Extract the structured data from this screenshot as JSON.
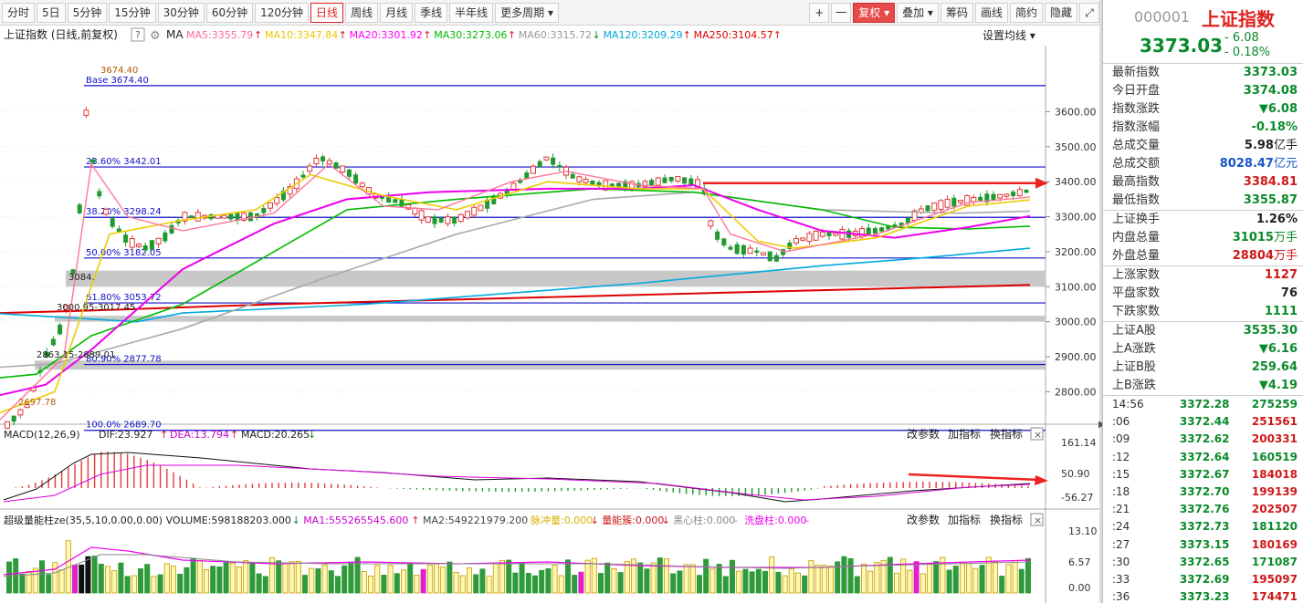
{
  "toolbar": {
    "periods": [
      "分时",
      "5日",
      "5分钟",
      "15分钟",
      "30分钟",
      "60分钟",
      "120分钟",
      "日线",
      "周线",
      "月线",
      "季线",
      "半年线",
      "更多周期"
    ],
    "active_period": "日线",
    "plus": "+",
    "minus": "一",
    "fuquan": "复权",
    "overlay": "叠加",
    "chips": "筹码",
    "draw": "画线",
    "simple": "简约",
    "hide": "隐藏"
  },
  "ma_bar": {
    "title": "上证指数 (日线,前复权)",
    "ma_label": "MA",
    "items": [
      {
        "label": "MA5:3355.79",
        "color": "#ff6699",
        "arrow": "↑"
      },
      {
        "label": "MA10:3347.84",
        "color": "#e8c800",
        "arrow": "↑"
      },
      {
        "label": "MA20:3301.92",
        "color": "#ff00ff",
        "arrow": "↑"
      },
      {
        "label": "MA30:3273.06",
        "color": "#00bb00",
        "arrow": "↑"
      },
      {
        "label": "MA60:3315.72",
        "color": "#999999",
        "arrow": "↓"
      },
      {
        "label": "MA120:3209.29",
        "color": "#00aadd",
        "arrow": "↑"
      },
      {
        "label": "MA250:3104.57",
        "color": "#dd0000",
        "arrow": "↑"
      }
    ],
    "settings": "设置均线"
  },
  "price_axis": [
    "3600.00",
    "3500.00",
    "3400.00",
    "3300.00",
    "3200.00",
    "3100.00",
    "3000.00",
    "2900.00",
    "2800.00"
  ],
  "fib": [
    {
      "label": "Base   3674.40"
    },
    {
      "label": "23.60% 3442.01"
    },
    {
      "label": "38.20% 3298.24"
    },
    {
      "label": "50.00% 3182.05"
    },
    {
      "label": "61.80% 3053.72"
    },
    {
      "label": "80.90% 2877.78"
    },
    {
      "label": "100.0% 2689.70"
    }
  ],
  "price_annotations": {
    "high": "3674.40",
    "low": "2697.78",
    "gap1": "3084.",
    "gap2": "3000.95-3017.45",
    "gap3": "2863.15-2889.01"
  },
  "macd": {
    "title": "MACD(12,26,9)",
    "dif": "DIF:23.927",
    "dea": "DEA:13.794",
    "macd": "MACD:20.265",
    "dif_arrow": "↑",
    "dea_arrow": "↑",
    "macd_arrow": "↓",
    "axis": [
      "161.14",
      "50.90",
      "-56.27"
    ],
    "btn_params": "改参数",
    "btn_add": "加指标",
    "btn_switch": "换指标",
    "close": "×"
  },
  "volume": {
    "title": "超级量能柱ze(35,5,10,0.00,0.00)",
    "volume": "VOLUME:598188203.000",
    "volume_arrow": "↓",
    "ma1": "MA1:555265545.600",
    "ma1_arrow": "↑",
    "ma2": "MA2:549221979.200",
    "pulse": "脉冲量:0.000",
    "pulse_arrow": "↓",
    "burst": "量能簇:0.000",
    "burst_arrow": "↓",
    "black": "黑心柱:0.000",
    "black_dash": "–",
    "wash": "洗盘柱:0.000",
    "wash_dash": "–",
    "axis": [
      "13.10",
      "6.57",
      "0.00"
    ],
    "btn_params": "改参数",
    "btn_add": "加指标",
    "btn_switch": "换指标",
    "close": "×"
  },
  "quote": {
    "code": "000001",
    "name": "上证指数",
    "price": "3373.03",
    "change": "- 6.08",
    "pct": "- 0.18%",
    "section1": [
      {
        "label": "最新指数",
        "value": "3373.03",
        "cls": "g"
      },
      {
        "label": "今日开盘",
        "value": "3374.08",
        "cls": "g"
      },
      {
        "label": "指数涨跌",
        "value": "▼6.08",
        "cls": "g"
      },
      {
        "label": "指数涨幅",
        "value": "-0.18%",
        "cls": "g"
      },
      {
        "label": "总成交量",
        "value": "5.98",
        "unit": "亿手",
        "cls": "k"
      },
      {
        "label": "总成交额",
        "value": "8028.47",
        "unit": "亿元",
        "cls": "b"
      },
      {
        "label": "最高指数",
        "value": "3384.81",
        "cls": "r"
      },
      {
        "label": "最低指数",
        "value": "3355.87",
        "cls": "g"
      }
    ],
    "section2": [
      {
        "label": "上证换手",
        "value": "1.26%",
        "cls": "k"
      },
      {
        "label": "内盘总量",
        "value": "31015",
        "unit": "万手",
        "cls": "g"
      },
      {
        "label": "外盘总量",
        "value": "28804",
        "unit": "万手",
        "cls": "r"
      }
    ],
    "section3": [
      {
        "label": "上涨家数",
        "value": "1127",
        "cls": "r"
      },
      {
        "label": "平盘家数",
        "value": "76",
        "cls": "k"
      },
      {
        "label": "下跌家数",
        "value": "1111",
        "cls": "g"
      }
    ],
    "section4": [
      {
        "label": "上证A股",
        "value": "3535.30",
        "cls": "g"
      },
      {
        "label": "上A涨跌",
        "value": "▼6.16",
        "cls": "g"
      },
      {
        "label": "上证B股",
        "value": "259.64",
        "cls": "g"
      },
      {
        "label": "上B涨跌",
        "value": "▼4.19",
        "cls": "g"
      }
    ],
    "ticks": [
      {
        "time": "14:56",
        "price": "3372.28",
        "vol": "275259",
        "vcls": "g"
      },
      {
        "time": ":06",
        "price": "3372.44",
        "vol": "251561",
        "vcls": "r"
      },
      {
        "time": ":09",
        "price": "3372.62",
        "vol": "200331",
        "vcls": "r"
      },
      {
        "time": ":12",
        "price": "3372.64",
        "vol": "160519",
        "vcls": "g"
      },
      {
        "time": ":15",
        "price": "3372.67",
        "vol": "184018",
        "vcls": "r"
      },
      {
        "time": ":18",
        "price": "3372.70",
        "vol": "199139",
        "vcls": "r"
      },
      {
        "time": ":21",
        "price": "3372.76",
        "vol": "202507",
        "vcls": "r"
      },
      {
        "time": ":24",
        "price": "3372.73",
        "vol": "181120",
        "vcls": "g"
      },
      {
        "time": ":27",
        "price": "3373.15",
        "vol": "180169",
        "vcls": "r"
      },
      {
        "time": ":30",
        "price": "3372.65",
        "vol": "171087",
        "vcls": "g"
      },
      {
        "time": ":33",
        "price": "3372.69",
        "vol": "195097",
        "vcls": "r"
      },
      {
        "time": ":36",
        "price": "3373.23",
        "vol": "174471",
        "vcls": "r"
      }
    ]
  }
}
